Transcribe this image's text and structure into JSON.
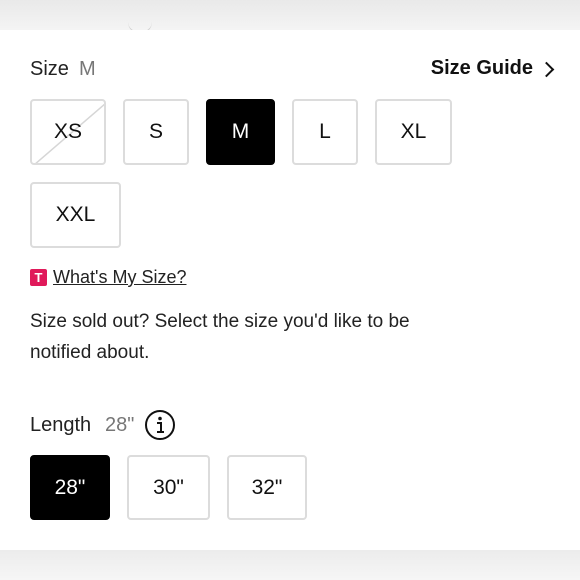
{
  "size": {
    "label": "Size",
    "selected": "M",
    "guide_label": "Size Guide",
    "options": [
      {
        "label": "XS",
        "state": "sold-out"
      },
      {
        "label": "S",
        "state": "available"
      },
      {
        "label": "M",
        "state": "selected"
      },
      {
        "label": "L",
        "state": "available"
      },
      {
        "label": "XL",
        "state": "available"
      },
      {
        "label": "XXL",
        "state": "available"
      }
    ]
  },
  "whats_my_size": {
    "badge": "T",
    "label": "What's My Size?"
  },
  "soldout_message": "Size sold out? Select the size you'd like to be notified about.",
  "length": {
    "label": "Length",
    "selected": "28\"",
    "info_icon": "info-circle-icon",
    "options": [
      {
        "label": "28\"",
        "state": "selected"
      },
      {
        "label": "30\"",
        "state": "available"
      },
      {
        "label": "32\"",
        "state": "available"
      }
    ]
  },
  "colors": {
    "selected_bg": "#000000",
    "badge": "#e0195a",
    "border": "#dcdcdc"
  },
  "icons": [
    "chevron-right-icon",
    "info-circle-icon",
    "t-badge-icon"
  ]
}
